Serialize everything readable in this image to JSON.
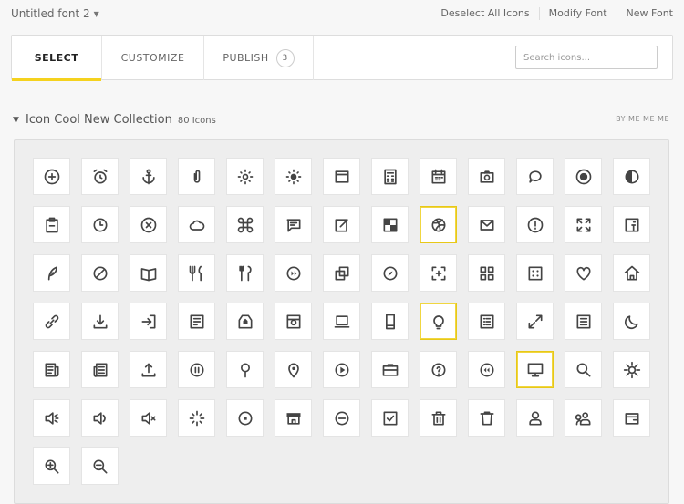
{
  "font": {
    "title": "Untitled font 2"
  },
  "top_links": {
    "deselect": "Deselect All Icons",
    "modify": "Modify Font",
    "new": "New Font"
  },
  "tabs": {
    "select": "SELECT",
    "customize": "CUSTOMIZE",
    "publish": "PUBLISH",
    "publish_count": "3"
  },
  "search": {
    "placeholder": "Search icons..."
  },
  "collection": {
    "name": "Icon Cool New Collection",
    "count": "80 Icons",
    "author": "BY ME ME ME"
  },
  "accent_color": "#f5d21e",
  "icons": [
    [
      "plus-circle",
      "alarm-clock",
      "anchor",
      "paperclip",
      "brightness",
      "sun",
      "browser-window",
      "calculator",
      "calendar",
      "camera",
      "speech-bubble",
      "record",
      "contrast"
    ],
    [
      "clipboard",
      "clock",
      "close-circle",
      "cloud",
      "command",
      "chat-message",
      "edit",
      "checker",
      "dribbble",
      "envelope",
      "exclamation-circle",
      "fullscreen",
      "facebook"
    ],
    [
      "feather",
      "forbidden",
      "book-open",
      "cutlery",
      "cutlery-2",
      "fast-forward",
      "copy",
      "compass",
      "focus-frame",
      "grid",
      "dice",
      "heart",
      "home"
    ],
    [
      "link",
      "download",
      "sign-in",
      "inbox",
      "tag",
      "instagram",
      "laptop",
      "mobile",
      "lightbulb",
      "list",
      "expand",
      "document-list",
      "moon"
    ],
    [
      "newspaper",
      "newspaper-2",
      "upload",
      "pause-circle",
      "map-pin",
      "location",
      "play-circle",
      "briefcase",
      "question-circle",
      "rewind",
      "monitor",
      "search",
      "settings"
    ],
    [
      "volume-low",
      "volume",
      "mute",
      "loading",
      "stop-circle",
      "store",
      "minus-circle",
      "check-square",
      "trash",
      "trash-2",
      "user",
      "users",
      "wallet"
    ],
    [
      "zoom-in",
      "zoom-out"
    ]
  ],
  "selected_icons": [
    "dribbble",
    "lightbulb",
    "monitor"
  ]
}
